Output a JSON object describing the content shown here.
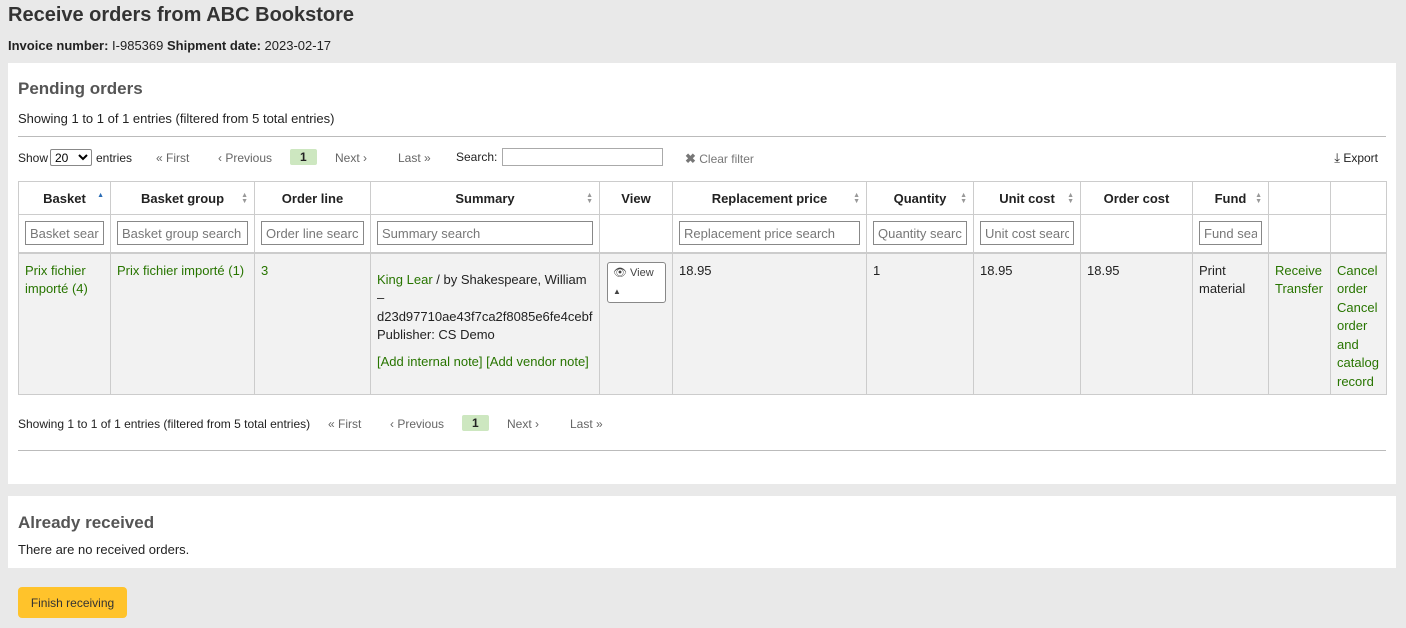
{
  "header": {
    "title": "Receive orders from ABC Bookstore",
    "invoice_label": "Invoice number:",
    "invoice_value": "I-985369",
    "shipment_label": "Shipment date:",
    "shipment_value": "2023-02-17"
  },
  "pending": {
    "title": "Pending orders",
    "info": "Showing 1 to 1 of 1 entries (filtered from 5 total entries)",
    "show_label": "Show",
    "entries_label": "entries",
    "page_size": "20",
    "pagination": {
      "first": "First",
      "previous": "Previous",
      "current": "1",
      "next": "Next",
      "last": "Last"
    },
    "search_label": "Search:",
    "clear_filter": "Clear filter",
    "export": "Export",
    "columns": [
      "Basket",
      "Basket group",
      "Order line",
      "Summary",
      "View",
      "Replacement price",
      "Quantity",
      "Unit cost",
      "Order cost",
      "Fund",
      "",
      ""
    ],
    "filter_placeholders": {
      "basket": "Basket search",
      "basket_group": "Basket group search",
      "order_line": "Order line search",
      "summary": "Summary search",
      "replacement_price": "Replacement price search",
      "quantity": "Quantity search",
      "unit_cost": "Unit cost search",
      "fund": "Fund search"
    },
    "row": {
      "basket": "Prix fichier importé (4)",
      "basket_group": "Prix fichier importé (1)",
      "order_line": "3",
      "summary_title": "King Lear",
      "summary_author": " / by Shakespeare, William",
      "summary_dash": "–",
      "summary_id": "d23d97710ae43f7ca2f8085e6fe4cebf",
      "summary_publisher": "Publisher: CS Demo",
      "add_internal_note": "[Add internal note]",
      "add_vendor_note": "[Add vendor note]",
      "view": "View",
      "replacement_price": "18.95",
      "quantity": "1",
      "unit_cost": "18.95",
      "order_cost": "18.95",
      "fund": "Print material",
      "receive": "Receive",
      "transfer": "Transfer",
      "cancel_order": "Cancel order",
      "cancel_order_catalog": "Cancel order and catalog record"
    }
  },
  "received": {
    "title": "Already received",
    "text": "There are no received orders."
  },
  "finish_button": "Finish receiving"
}
